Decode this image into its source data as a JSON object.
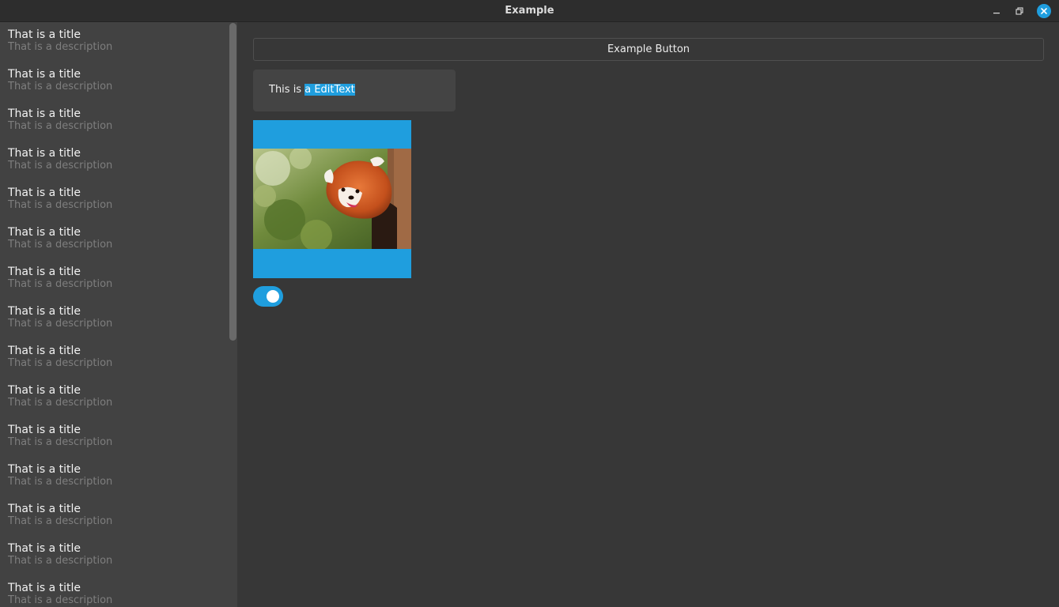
{
  "window": {
    "title": "Example",
    "controls": [
      {
        "name": "minimize",
        "icon": "minimize-icon"
      },
      {
        "name": "maximize",
        "icon": "maximize-icon"
      },
      {
        "name": "close",
        "icon": "close-icon"
      }
    ],
    "accent_color": "#1f9ede"
  },
  "sidebar": {
    "items": [
      {
        "title": "That is a title",
        "description": "That is a description"
      },
      {
        "title": "That is a title",
        "description": "That is a description"
      },
      {
        "title": "That is a title",
        "description": "That is a description"
      },
      {
        "title": "That is a title",
        "description": "That is a description"
      },
      {
        "title": "That is a title",
        "description": "That is a description"
      },
      {
        "title": "That is a title",
        "description": "That is a description"
      },
      {
        "title": "That is a title",
        "description": "That is a description"
      },
      {
        "title": "That is a title",
        "description": "That is a description"
      },
      {
        "title": "That is a title",
        "description": "That is a description"
      },
      {
        "title": "That is a title",
        "description": "That is a description"
      },
      {
        "title": "That is a title",
        "description": "That is a description"
      },
      {
        "title": "That is a title",
        "description": "That is a description"
      },
      {
        "title": "That is a title",
        "description": "That is a description"
      },
      {
        "title": "That is a title",
        "description": "That is a description"
      },
      {
        "title": "That is a title",
        "description": "That is a description"
      }
    ]
  },
  "main": {
    "button_label": "Example Button",
    "edit_text": {
      "prefix": "This is ",
      "selected": "a EditText"
    },
    "image": {
      "subject": "red-panda-photo"
    },
    "toggle": {
      "on": true
    }
  }
}
